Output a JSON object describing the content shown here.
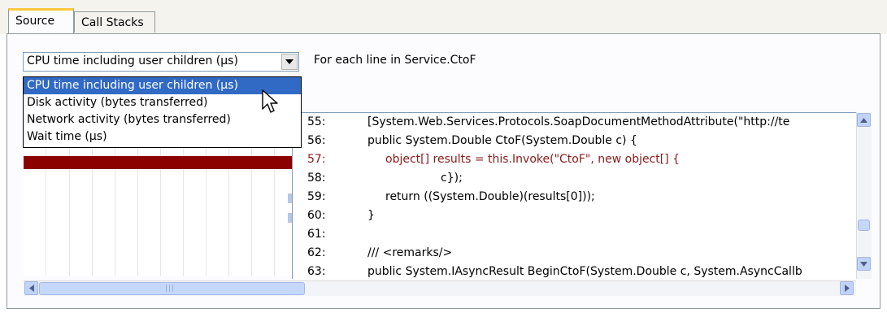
{
  "tabs": [
    {
      "label": "Source",
      "active": true
    },
    {
      "label": "Call Stacks",
      "active": false
    }
  ],
  "metric_select": {
    "value": "CPU time including user children (µs)",
    "options": [
      "CPU time including user children (µs)",
      "Disk activity (bytes transferred)",
      "Network activity (bytes transferred)",
      "Wait time (µs)"
    ],
    "highlighted_index": 0
  },
  "caption": "For each line in Service.CtoF",
  "code_lines": [
    {
      "num": "55:",
      "text": "[System.Web.Services.Protocols.SoapDocumentMethodAttribute(\"http://te",
      "hot": false
    },
    {
      "num": "56:",
      "text": "public System.Double CtoF(System.Double c) {",
      "hot": false
    },
    {
      "num": "57:",
      "text": "object[] results = this.Invoke(\"CtoF\", new object[] {",
      "hot": true
    },
    {
      "num": "58:",
      "text": "c});",
      "hot": false
    },
    {
      "num": "59:",
      "text": "return ((System.Double)(results[0]));",
      "hot": false
    },
    {
      "num": "60:",
      "text": "}",
      "hot": false
    },
    {
      "num": "61:",
      "text": "",
      "hot": false
    },
    {
      "num": "62:",
      "text": "/// <remarks/>",
      "hot": false
    },
    {
      "num": "63:",
      "text": "public System.IAsyncResult BeginCtoF(System.Double c, System.AsyncCallb",
      "hot": false
    }
  ],
  "colors": {
    "hot_bar": "#8b0000",
    "selection": "#316ac5",
    "hot_text": "#8b1a1a"
  },
  "icons": {
    "dropdown": "chevron-down-icon",
    "cursor": "mouse-pointer-icon",
    "scroll_up": "scroll-up-arrow-icon",
    "scroll_down": "scroll-down-arrow-icon",
    "scroll_left": "scroll-left-arrow-icon",
    "scroll_right": "scroll-right-arrow-icon"
  }
}
